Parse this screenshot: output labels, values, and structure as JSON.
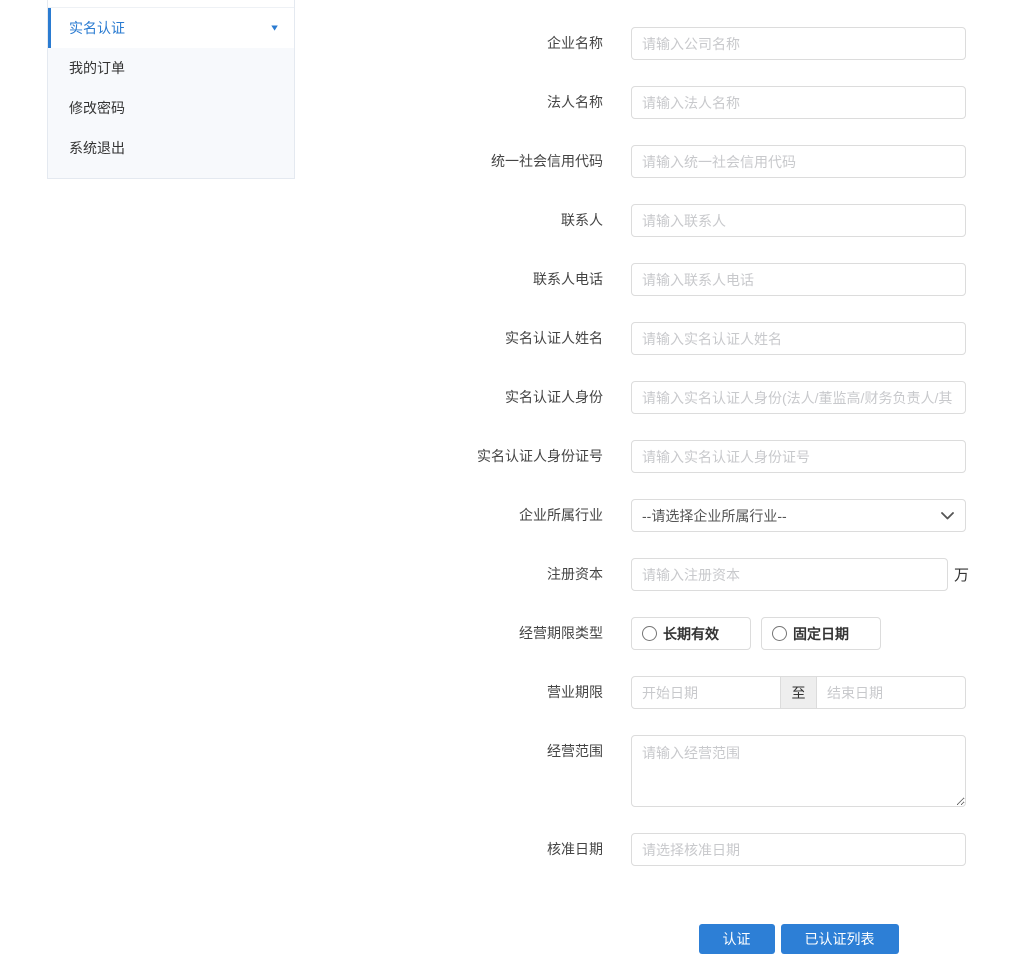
{
  "colors": {
    "primary_button": "#2d7fd6",
    "sidebar_active_text": "#2a7bd1",
    "sidebar_active_bar": "#2a7bd1",
    "input_border": "#dcdcdc",
    "placeholder": "#c8c9cc"
  },
  "sidebar": {
    "items": [
      {
        "label": "实名认证",
        "active": true,
        "caret": "▼"
      },
      {
        "label": "我的订单",
        "active": false
      },
      {
        "label": "修改密码",
        "active": false
      },
      {
        "label": "系统退出",
        "active": false
      }
    ]
  },
  "form": {
    "fields": {
      "company_name": {
        "label": "企业名称",
        "placeholder": "请输入公司名称"
      },
      "legal_person": {
        "label": "法人名称",
        "placeholder": "请输入法人名称"
      },
      "credit_code": {
        "label": "统一社会信用代码",
        "placeholder": "请输入统一社会信用代码"
      },
      "contact": {
        "label": "联系人",
        "placeholder": "请输入联系人"
      },
      "contact_phone": {
        "label": "联系人电话",
        "placeholder": "请输入联系人电话"
      },
      "certifier_name": {
        "label": "实名认证人姓名",
        "placeholder": "请输入实名认证人姓名"
      },
      "certifier_identity": {
        "label": "实名认证人身份",
        "placeholder": "请输入实名认证人身份(法人/董监高/财务负责人/其"
      },
      "certifier_id_no": {
        "label": "实名认证人身份证号",
        "placeholder": "请输入实名认证人身份证号"
      },
      "industry": {
        "label": "企业所属行业",
        "selected_option": "--请选择企业所属行业--"
      },
      "registered_capital": {
        "label": "注册资本",
        "placeholder": "请输入注册资本",
        "unit": "万"
      },
      "term_type": {
        "label": "经营期限类型",
        "options": [
          {
            "label": "长期有效",
            "checked": false
          },
          {
            "label": "固定日期",
            "checked": false
          }
        ]
      },
      "business_period": {
        "label": "营业期限",
        "start_placeholder": "开始日期",
        "separator": "至",
        "end_placeholder": "结束日期"
      },
      "business_scope": {
        "label": "经营范围",
        "placeholder": "请输入经营范围"
      },
      "approval_date": {
        "label": "核准日期",
        "placeholder": "请选择核准日期"
      }
    },
    "actions": {
      "certify": "认证",
      "certified_list": "已认证列表"
    }
  }
}
